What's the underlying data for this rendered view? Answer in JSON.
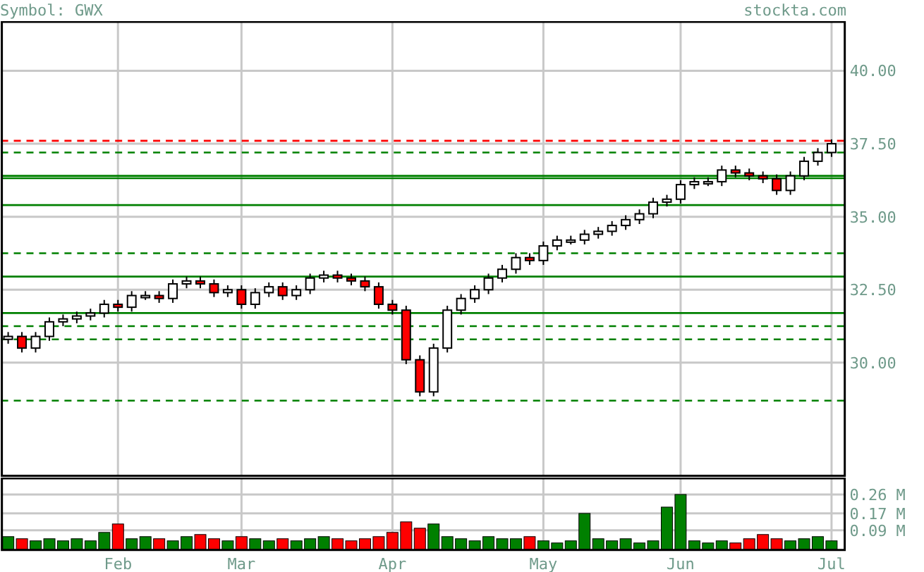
{
  "header": {
    "symbol_label": "Symbol: GWX",
    "site": "stockta.com"
  },
  "price_chart": {
    "chart_data": {
      "type": "candlestick",
      "grid": true,
      "ylim": [
        26.15,
        41.7
      ],
      "yticks": [
        {
          "value": 30,
          "label": "30.00"
        },
        {
          "value": 32.5,
          "label": "32.50"
        },
        {
          "value": 35,
          "label": "35.00"
        },
        {
          "value": 37.5,
          "label": "37.50"
        },
        {
          "value": 40,
          "label": "40.00"
        }
      ],
      "ohlc": [
        [
          30.8,
          31.05,
          30.65,
          30.9
        ],
        [
          30.9,
          31.05,
          30.35,
          30.5
        ],
        [
          30.5,
          31.05,
          30.35,
          30.9
        ],
        [
          30.9,
          31.55,
          30.75,
          31.4
        ],
        [
          31.4,
          31.65,
          31.25,
          31.5
        ],
        [
          31.5,
          31.75,
          31.35,
          31.6
        ],
        [
          31.6,
          31.85,
          31.45,
          31.7
        ],
        [
          31.7,
          32.15,
          31.55,
          32.0
        ],
        [
          32.0,
          32.15,
          31.75,
          31.9
        ],
        [
          31.9,
          32.45,
          31.75,
          32.3
        ],
        [
          32.3,
          32.45,
          32.15,
          32.3
        ],
        [
          32.3,
          32.45,
          32.05,
          32.2
        ],
        [
          32.2,
          32.85,
          32.05,
          32.7
        ],
        [
          32.7,
          32.95,
          32.55,
          32.8
        ],
        [
          32.8,
          32.95,
          32.55,
          32.7
        ],
        [
          32.7,
          32.85,
          32.25,
          32.4
        ],
        [
          32.4,
          32.65,
          32.25,
          32.5
        ],
        [
          32.5,
          32.65,
          31.85,
          32.0
        ],
        [
          32.0,
          32.55,
          31.85,
          32.4
        ],
        [
          32.4,
          32.75,
          32.25,
          32.6
        ],
        [
          32.6,
          32.75,
          32.15,
          32.3
        ],
        [
          32.3,
          32.65,
          32.15,
          32.5
        ],
        [
          32.5,
          33.05,
          32.35,
          32.9
        ],
        [
          32.9,
          33.15,
          32.75,
          33.0
        ],
        [
          33.0,
          33.15,
          32.75,
          32.9
        ],
        [
          32.9,
          33.05,
          32.65,
          32.8
        ],
        [
          32.8,
          32.95,
          32.45,
          32.6
        ],
        [
          32.6,
          32.75,
          31.85,
          32.0
        ],
        [
          32.0,
          32.15,
          31.65,
          31.8
        ],
        [
          31.8,
          31.95,
          29.95,
          30.1
        ],
        [
          30.1,
          30.25,
          28.85,
          29.0
        ],
        [
          29.0,
          30.65,
          28.85,
          30.5
        ],
        [
          30.5,
          31.95,
          30.35,
          31.8
        ],
        [
          31.8,
          32.35,
          31.65,
          32.2
        ],
        [
          32.2,
          32.65,
          32.05,
          32.5
        ],
        [
          32.5,
          33.05,
          32.35,
          32.9
        ],
        [
          32.9,
          33.35,
          32.75,
          33.2
        ],
        [
          33.2,
          33.75,
          33.05,
          33.6
        ],
        [
          33.6,
          33.75,
          33.35,
          33.5
        ],
        [
          33.5,
          34.15,
          33.35,
          34.0
        ],
        [
          34.0,
          34.35,
          33.85,
          34.2
        ],
        [
          34.2,
          34.35,
          34.05,
          34.2
        ],
        [
          34.2,
          34.55,
          34.05,
          34.4
        ],
        [
          34.4,
          34.65,
          34.25,
          34.5
        ],
        [
          34.5,
          34.85,
          34.35,
          34.7
        ],
        [
          34.7,
          35.05,
          34.55,
          34.9
        ],
        [
          34.9,
          35.25,
          34.75,
          35.1
        ],
        [
          35.1,
          35.65,
          34.95,
          35.5
        ],
        [
          35.5,
          35.75,
          35.35,
          35.6
        ],
        [
          35.6,
          36.25,
          35.45,
          36.1
        ],
        [
          36.1,
          36.35,
          35.95,
          36.2
        ],
        [
          36.2,
          36.35,
          36.05,
          36.2
        ],
        [
          36.2,
          36.75,
          36.05,
          36.6
        ],
        [
          36.6,
          36.75,
          36.35,
          36.5
        ],
        [
          36.5,
          36.65,
          36.25,
          36.4
        ],
        [
          36.4,
          36.55,
          36.15,
          36.3
        ],
        [
          36.3,
          36.45,
          35.75,
          35.9
        ],
        [
          35.9,
          36.55,
          35.75,
          36.4
        ],
        [
          36.4,
          37.05,
          36.25,
          36.9
        ],
        [
          36.9,
          37.35,
          36.75,
          37.2
        ],
        [
          37.2,
          37.65,
          37.05,
          37.5
        ]
      ],
      "ref_lines": [
        {
          "axis": "y",
          "value": 37.6,
          "color": "#ff0000"
        },
        {
          "axis": "y",
          "value": 37.2,
          "color": "#008000"
        },
        {
          "axis": "y",
          "value": 36.4,
          "color": "#008000"
        },
        {
          "axis": "y",
          "value": 36.32,
          "color": "#008000"
        },
        {
          "axis": "y",
          "value": 35.4,
          "color": "#008000"
        },
        {
          "axis": "y",
          "value": 33.75,
          "color": "#008000"
        },
        {
          "axis": "y",
          "value": 32.95,
          "color": "#008000"
        },
        {
          "axis": "y",
          "value": 31.7,
          "color": "#008000"
        },
        {
          "axis": "y",
          "value": 31.25,
          "color": "#008000"
        },
        {
          "axis": "y",
          "value": 30.8,
          "color": "#008000"
        },
        {
          "axis": "y",
          "value": 28.7,
          "color": "#008000"
        }
      ]
    }
  },
  "volume_chart": {
    "chart_data": {
      "type": "bar",
      "stacked": true,
      "grid": true,
      "ylim": [
        0,
        0.34
      ],
      "yticks": [
        {
          "value": 0.09,
          "label": "0.09 M"
        },
        {
          "value": 0.17,
          "label": "0.17 M"
        },
        {
          "value": 0.26,
          "label": "0.26 M"
        }
      ],
      "categories": [
        null,
        null,
        null,
        null,
        null,
        null,
        null,
        null,
        "Feb",
        null,
        null,
        null,
        null,
        null,
        null,
        null,
        null,
        "Mar",
        null,
        null,
        null,
        null,
        null,
        null,
        null,
        null,
        null,
        null,
        "Apr",
        null,
        null,
        null,
        null,
        null,
        null,
        null,
        null,
        null,
        null,
        "May",
        null,
        null,
        null,
        null,
        null,
        null,
        null,
        null,
        null,
        "Jun",
        null,
        null,
        null,
        null,
        null,
        null,
        null,
        null,
        null,
        null,
        "Jul"
      ],
      "series": [
        {
          "color": "#008000",
          "values": [
            0.06,
            null,
            0.04,
            0.05,
            0.04,
            0.05,
            0.04,
            0.08,
            null,
            0.05,
            0.06,
            null,
            0.04,
            0.06,
            null,
            null,
            0.04,
            null,
            0.05,
            0.04,
            null,
            0.04,
            0.05,
            0.06,
            null,
            null,
            null,
            null,
            null,
            null,
            null,
            0.12,
            0.06,
            0.05,
            0.04,
            0.06,
            0.05,
            0.05,
            null,
            0.04,
            0.03,
            0.04,
            0.17,
            0.05,
            0.04,
            0.05,
            0.03,
            0.04,
            0.2,
            0.26,
            0.04,
            0.03,
            0.04,
            null,
            null,
            null,
            null,
            0.04,
            0.05,
            0.06,
            0.04
          ]
        },
        {
          "color": "#ff0000",
          "values": [
            null,
            0.05,
            null,
            null,
            null,
            null,
            null,
            null,
            0.12,
            null,
            null,
            0.05,
            null,
            null,
            0.07,
            0.05,
            null,
            0.06,
            null,
            null,
            0.05,
            null,
            null,
            null,
            0.05,
            0.04,
            0.05,
            0.06,
            0.08,
            0.13,
            0.1,
            null,
            null,
            null,
            null,
            null,
            null,
            null,
            0.06,
            null,
            null,
            null,
            null,
            null,
            null,
            null,
            null,
            null,
            null,
            null,
            null,
            null,
            null,
            0.03,
            0.05,
            0.07,
            0.05,
            null,
            null,
            null,
            null
          ]
        }
      ]
    }
  }
}
